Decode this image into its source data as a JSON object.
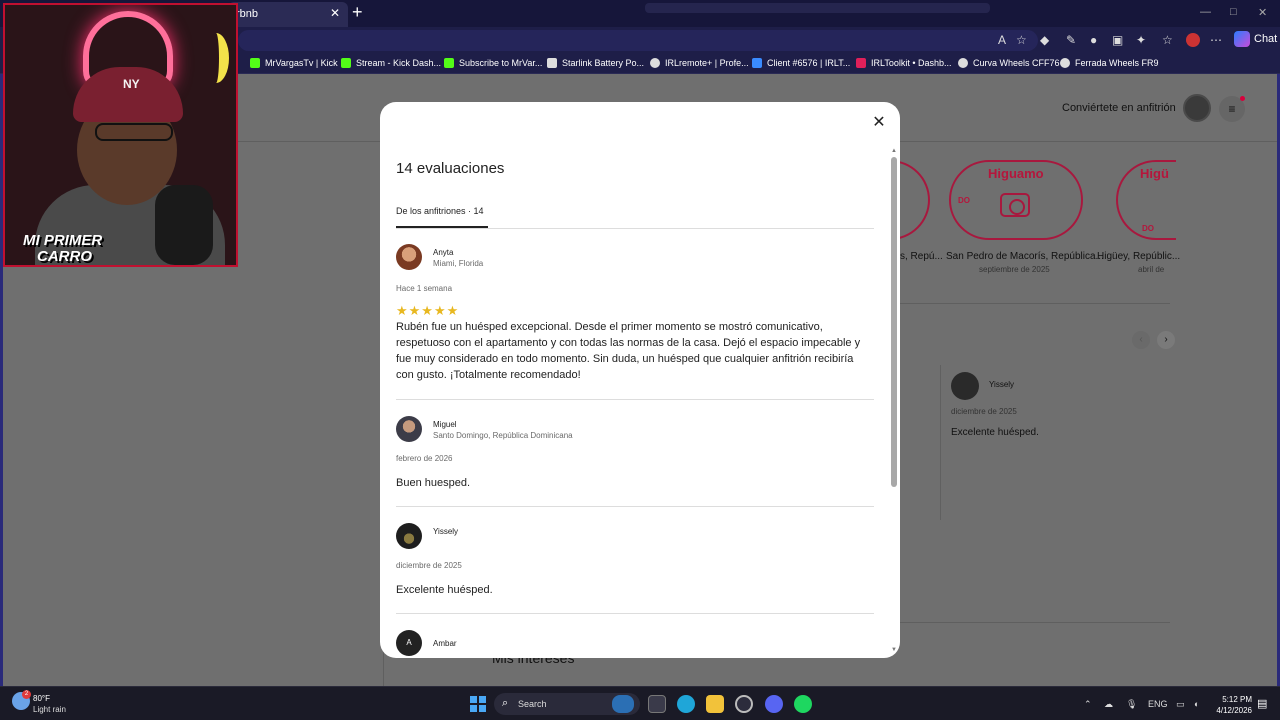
{
  "browser": {
    "tab_title": "rbnb",
    "tab_close": "✕",
    "new_tab": "+",
    "chat_label": "Chat",
    "bookmarks": [
      {
        "label": "MrVargasTv | Kick",
        "color": "#53fc18"
      },
      {
        "label": "Stream - Kick Dash...",
        "color": "#53fc18"
      },
      {
        "label": "Subscribe to MrVar...",
        "color": "#53fc18"
      },
      {
        "label": "Starlink Battery Po...",
        "color": "#dddddd"
      },
      {
        "label": "IRLremote+ | Profe...",
        "color": "#dddddd"
      },
      {
        "label": "Client #6576 | IRLT...",
        "color": "#3a8bff"
      },
      {
        "label": "IRLToolkit • Dashb...",
        "color": "#e0205a"
      },
      {
        "label": "Curva Wheels CFF76",
        "color": "#dddddd"
      },
      {
        "label": "Ferrada Wheels FR9",
        "color": "#dddddd"
      }
    ]
  },
  "webcam": {
    "overlay_line1": "MI PRIMER",
    "overlay_line2": "CARRO",
    "cap_logo": "NY"
  },
  "page": {
    "host_link": "Conviértete en anfitrión",
    "menu_icon": "≡",
    "badges": [
      {
        "name": "s, Repú...",
        "date": ""
      },
      {
        "title": "Higuamo",
        "code": "DO",
        "name": "San Pedro de Macorís, República...",
        "date": "septiembre de 2025"
      },
      {
        "title": "Higü",
        "code": "DO",
        "name": "Higüey, Repúblic...",
        "date": "abril de"
      }
    ],
    "carousel_prev": "‹",
    "carousel_next": "›",
    "bg_review": {
      "name": "Yissely",
      "date": "diciembre de 2025",
      "text": "Excelente huésped."
    },
    "bg_section": "Mis intereses"
  },
  "modal": {
    "close": "✕",
    "title": "14 evaluaciones",
    "tab_label": "De los anfitriones · 14",
    "reviews": [
      {
        "name": "Anyta",
        "location": "Miami, Florida",
        "date": "Hace 1 semana",
        "stars": "★★★★★",
        "rating": 5,
        "text": "Rubén fue un huésped excepcional. Desde el primer momento se mostró comunicativo, respetuoso con el apartamento y con todas las normas de la casa. Dejó el espacio impecable y fue muy considerado en todo momento. Sin duda, un huésped que cualquier anfitrión recibiría con gusto. ¡Totalmente recomendado!"
      },
      {
        "name": "Miguel",
        "location": "Santo Domingo, República Dominicana",
        "date": "febrero de 2026",
        "text": "Buen huesped."
      },
      {
        "name": "Yissely",
        "location": "",
        "date": "diciembre de 2025",
        "text": "Excelente huésped."
      },
      {
        "name": "Ambar",
        "initial": "A",
        "location": ""
      }
    ]
  },
  "taskbar": {
    "temperature": "80°F",
    "condition": "Light rain",
    "weather_badge": "2",
    "search_label": "Search",
    "lang": "ENG",
    "time": "5:12 PM",
    "date": "4/12/2026"
  }
}
